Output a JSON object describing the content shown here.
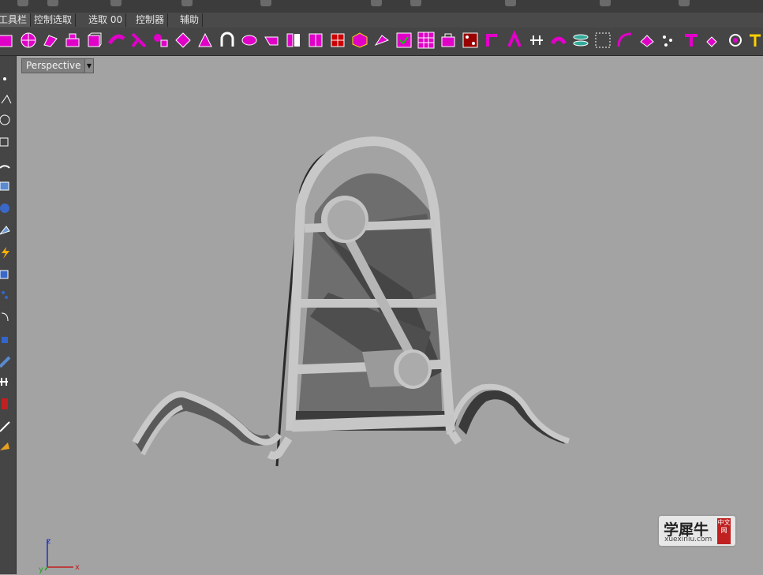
{
  "toolbar_tabs": [
    {
      "label": "工具栏"
    },
    {
      "label": "控制选取"
    },
    {
      "label": "选取 00"
    },
    {
      "label": "控制器"
    },
    {
      "label": "辅助"
    }
  ],
  "viewport": {
    "label": "Perspective",
    "dropdown_icon": "chevron-down-icon"
  },
  "axis": {
    "z": "z",
    "y": "y",
    "x": "x"
  },
  "watermark": {
    "name": "学犀牛",
    "url": "xuexiniu.com",
    "seal": "中文网"
  },
  "colors": {
    "accent": "#e000c8",
    "viewport_bg": "#a3a3a3",
    "toolbar_bg": "#454545",
    "axis_x": "#c02020",
    "axis_y": "#20a020",
    "axis_z": "#2030c0"
  }
}
